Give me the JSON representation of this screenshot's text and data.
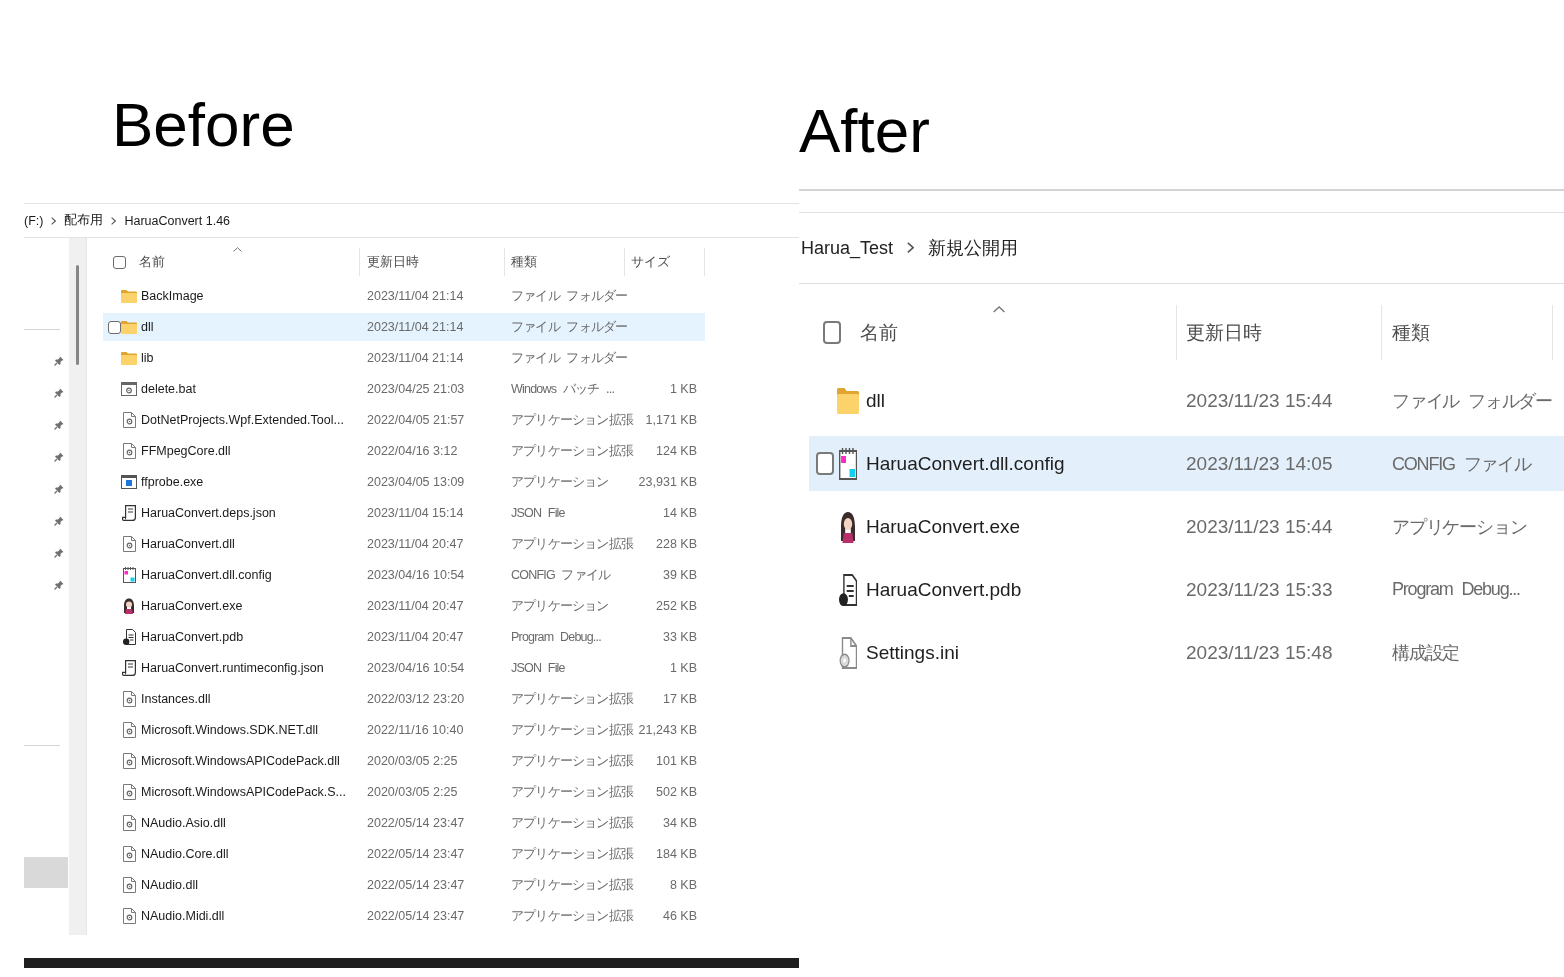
{
  "before": {
    "heading": "Before",
    "breadcrumb": [
      "(F:)",
      "配布用",
      "HaruaConvert 1.46"
    ],
    "select_all": {
      "checked": false
    },
    "columns": [
      {
        "label": "名前",
        "sorted": true
      },
      {
        "label": "更新日時",
        "sorted": false
      },
      {
        "label": "種類",
        "sorted": false
      },
      {
        "label": "サイズ",
        "sorted": false
      }
    ],
    "rows": [
      {
        "kind": "folder",
        "name": "BackImage",
        "modified": "2023/11/04 21:14",
        "type": "ファイル フォルダー",
        "selected": false
      },
      {
        "kind": "folder",
        "name": "dll",
        "modified": "2023/11/04 21:14",
        "type": "ファイル フォルダー",
        "selected": true
      },
      {
        "kind": "folder",
        "name": "lib",
        "modified": "2023/11/04 21:14",
        "type": "ファイル フォルダー",
        "selected": false
      },
      {
        "kind": "batch",
        "name": "delete.bat",
        "modified": "2023/04/25 21:03",
        "type": "Windows バッチ ...",
        "size": "1 KB",
        "selected": false
      },
      {
        "kind": "library",
        "name": "DotNetProjects.Wpf.Extended.Tool...",
        "modified": "2022/04/05 21:57",
        "type": "アプリケーション拡張",
        "size": "1,171 KB",
        "selected": false
      },
      {
        "kind": "library",
        "name": "FFMpegCore.dll",
        "modified": "2022/04/16 3:12",
        "type": "アプリケーション拡張",
        "size": "124 KB",
        "selected": false
      },
      {
        "kind": "program",
        "name": "ffprobe.exe",
        "modified": "2023/04/05 13:09",
        "type": "アプリケーション",
        "size": "23,931 KB",
        "selected": false
      },
      {
        "kind": "json",
        "name": "HaruaConvert.deps.json",
        "modified": "2023/11/04 15:14",
        "type": "JSON File",
        "size": "14 KB",
        "selected": false
      },
      {
        "kind": "library",
        "name": "HaruaConvert.dll",
        "modified": "2023/11/04 20:47",
        "type": "アプリケーション拡張",
        "size": "228 KB",
        "selected": false
      },
      {
        "kind": "config",
        "name": "HaruaConvert.dll.config",
        "modified": "2023/04/16 10:54",
        "type": "CONFIG ファイル",
        "size": "39 KB",
        "selected": false
      },
      {
        "kind": "app",
        "name": "HaruaConvert.exe",
        "modified": "2023/11/04 20:47",
        "type": "アプリケーション",
        "size": "252 KB",
        "selected": false
      },
      {
        "kind": "debug",
        "name": "HaruaConvert.pdb",
        "modified": "2023/11/04 20:47",
        "type": "Program Debug...",
        "size": "33 KB",
        "selected": false
      },
      {
        "kind": "json",
        "name": "HaruaConvert.runtimeconfig.json",
        "modified": "2023/04/16 10:54",
        "type": "JSON File",
        "size": "1 KB",
        "selected": false
      },
      {
        "kind": "library",
        "name": "Instances.dll",
        "modified": "2022/03/12 23:20",
        "type": "アプリケーション拡張",
        "size": "17 KB",
        "selected": false
      },
      {
        "kind": "library",
        "name": "Microsoft.Windows.SDK.NET.dll",
        "modified": "2022/11/16 10:40",
        "type": "アプリケーション拡張",
        "size": "21,243 KB",
        "selected": false
      },
      {
        "kind": "library",
        "name": "Microsoft.WindowsAPICodePack.dll",
        "modified": "2020/03/05 2:25",
        "type": "アプリケーション拡張",
        "size": "101 KB",
        "selected": false
      },
      {
        "kind": "library",
        "name": "Microsoft.WindowsAPICodePack.S...",
        "modified": "2020/03/05 2:25",
        "type": "アプリケーション拡張",
        "size": "502 KB",
        "selected": false
      },
      {
        "kind": "library",
        "name": "NAudio.Asio.dll",
        "modified": "2022/05/14 23:47",
        "type": "アプリケーション拡張",
        "size": "34 KB",
        "selected": false
      },
      {
        "kind": "library",
        "name": "NAudio.Core.dll",
        "modified": "2022/05/14 23:47",
        "type": "アプリケーション拡張",
        "size": "184 KB",
        "selected": false
      },
      {
        "kind": "library",
        "name": "NAudio.dll",
        "modified": "2022/05/14 23:47",
        "type": "アプリケーション拡張",
        "size": "8 KB",
        "selected": false
      },
      {
        "kind": "library",
        "name": "NAudio.Midi.dll",
        "modified": "2022/05/14 23:47",
        "type": "アプリケーション拡張",
        "size": "46 KB",
        "selected": false
      }
    ]
  },
  "after": {
    "heading": "After",
    "breadcrumb": [
      "Harua_Test",
      "新規公開用"
    ],
    "select_all": {
      "checked": false
    },
    "columns": [
      {
        "label": "名前",
        "sorted": true
      },
      {
        "label": "更新日時",
        "sorted": false
      },
      {
        "label": "種類",
        "sorted": false
      }
    ],
    "rows": [
      {
        "kind": "folder",
        "name": "dll",
        "modified": "2023/11/23 15:44",
        "type": "ファイル フォルダー",
        "selected": false
      },
      {
        "kind": "config",
        "name": "HaruaConvert.dll.config",
        "modified": "2023/11/23 14:05",
        "type": "CONFIG ファイル",
        "selected": true
      },
      {
        "kind": "app",
        "name": "HaruaConvert.exe",
        "modified": "2023/11/23 15:44",
        "type": "アプリケーション",
        "selected": false
      },
      {
        "kind": "debug",
        "name": "HaruaConvert.pdb",
        "modified": "2023/11/23 15:33",
        "type": "Program Debug...",
        "selected": false
      },
      {
        "kind": "settings",
        "name": "Settings.ini",
        "modified": "2023/11/23 15:48",
        "type": "構成設定",
        "selected": false
      }
    ]
  }
}
